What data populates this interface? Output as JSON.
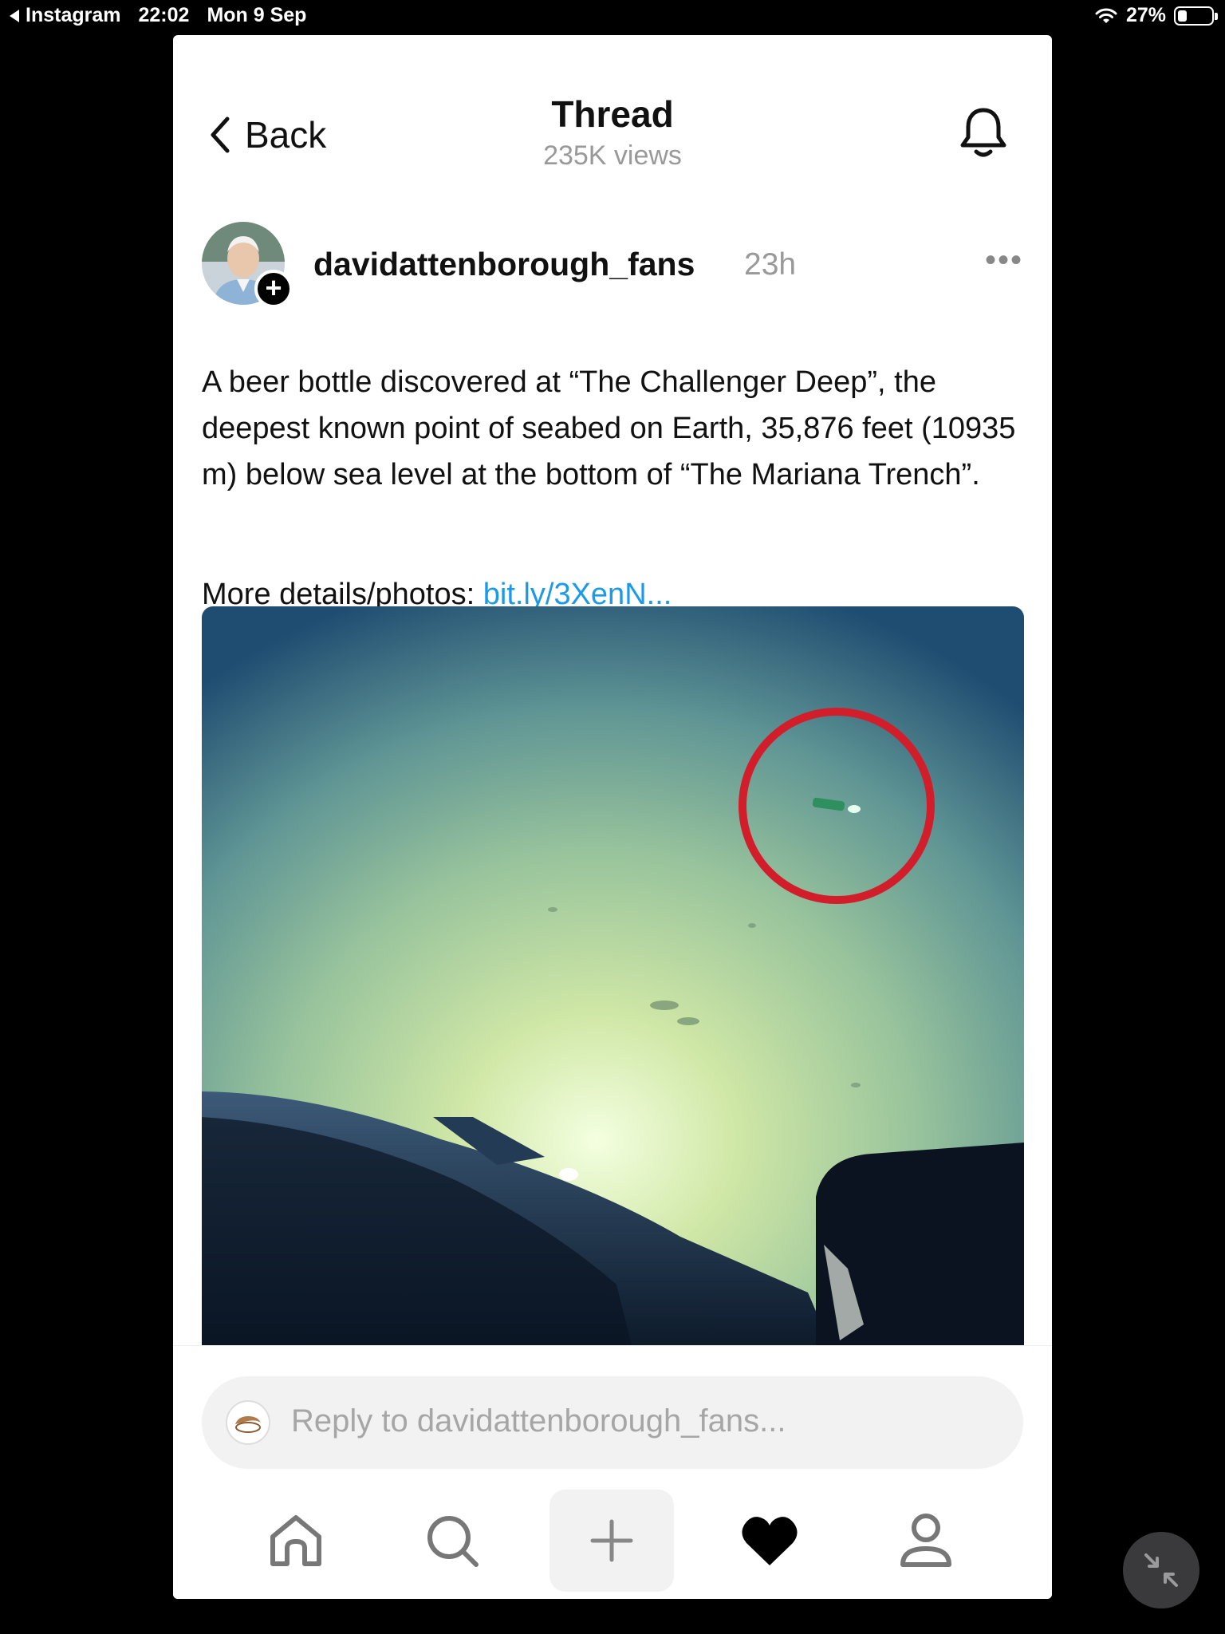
{
  "status_bar": {
    "back_app": "Instagram",
    "time": "22:02",
    "date": "Mon 9 Sep",
    "battery": "27%",
    "battery_level": 0.27
  },
  "header": {
    "back_label": "Back",
    "title": "Thread",
    "views": "235K views"
  },
  "post": {
    "username": "davidattenborough_fans",
    "time": "23h",
    "more": "•••",
    "follow": "+",
    "text": "A beer bottle discovered at “The Challenger Deep”, the deepest known point of seabed on Earth, 35,876 feet (10935 m) below sea level at the bottom of “The Mariana Trench”.",
    "details_label": "More details/photos: ",
    "details_link": "bit.ly/3XenN..."
  },
  "reply": {
    "placeholder": "Reply to davidattenborough_fans..."
  },
  "nav": {
    "items": [
      "home-icon",
      "search-icon",
      "plus-icon",
      "heart-icon",
      "profile-icon"
    ],
    "active": "heart-icon"
  },
  "colors": {
    "link": "#1a9ae8",
    "background": "#000000",
    "card": "#ffffff"
  }
}
